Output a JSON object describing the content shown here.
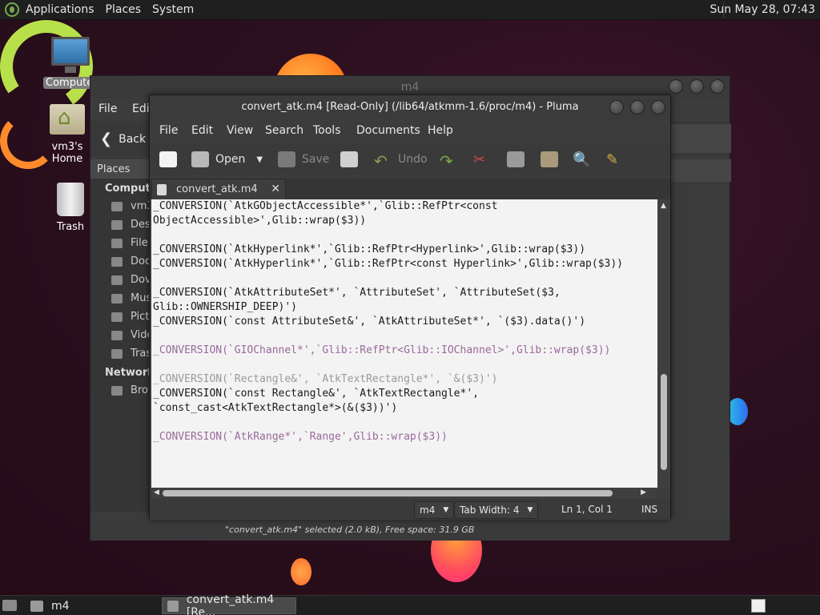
{
  "top_panel": {
    "menus": [
      "Applications",
      "Places",
      "System"
    ],
    "clock": "Sun May 28, 07:43"
  },
  "desktop_icons": [
    {
      "label": "Computer",
      "icon": "computer-icon"
    },
    {
      "label": "vm3's Home",
      "icon": "home-folder-icon"
    },
    {
      "label": "Trash",
      "icon": "trash-icon"
    }
  ],
  "file_manager": {
    "title": "m4",
    "menus": [
      "File",
      "Edit"
    ],
    "back_label": "Back",
    "places_header": "Places",
    "computer_section": "Computer",
    "items": [
      "vm3",
      "Des",
      "File",
      "Doc",
      "Dov",
      "Mus",
      "Pictu",
      "Vide",
      "Tras"
    ],
    "network_section": "Network",
    "network_items": [
      "Brow"
    ],
    "status": "\"convert_atk.m4\" selected (2.0 kB), Free space: 31.9 GB"
  },
  "pluma": {
    "title": "convert_atk.m4 [Read-Only] (/lib64/atkmm-1.6/proc/m4) - Pluma",
    "menus": [
      "File",
      "Edit",
      "View",
      "Search",
      "Tools",
      "Documents",
      "Help"
    ],
    "toolbar": {
      "open": "Open",
      "save": "Save",
      "undo": "Undo"
    },
    "tab_label": "convert_atk.m4",
    "lines": [
      "_CONVERSION(`AtkGObjectAccessible*',`Glib::RefPtr<const",
      "ObjectAccessible>',Glib::wrap($3))",
      "",
      "_CONVERSION(`AtkHyperlink*',`Glib::RefPtr<Hyperlink>',Glib::wrap($3))",
      "_CONVERSION(`AtkHyperlink*',`Glib::RefPtr<const Hyperlink>',Glib::wrap($3))",
      "",
      "_CONVERSION(`AtkAttributeSet*', `AttributeSet', `AttributeSet($3,",
      "Glib::OWNERSHIP_DEEP)')",
      "_CONVERSION(`const AttributeSet&', `AtkAttributeSet*', `($3).data()')",
      "",
      "_CONVERSION(`GIOChannel*',`Glib::RefPtr<Glib::IOChannel>',Glib::wrap($3))",
      "",
      "_CONVERSION(`Rectangle&', `AtkTextRectangle*', `&($3)')",
      "_CONVERSION(`const Rectangle&', `AtkTextRectangle*',",
      "`const_cast<AtkTextRectangle*>(&($3))')",
      "",
      "_CONVERSION(`AtkRange*',`Range',Glib::wrap($3))"
    ],
    "status": {
      "language": "m4",
      "tab_width": "Tab Width:  4",
      "position": "Ln 1, Col 1",
      "mode": "INS"
    }
  },
  "bottom_panel": {
    "tasks": [
      "m4",
      "convert_atk.m4 [Re..."
    ]
  }
}
